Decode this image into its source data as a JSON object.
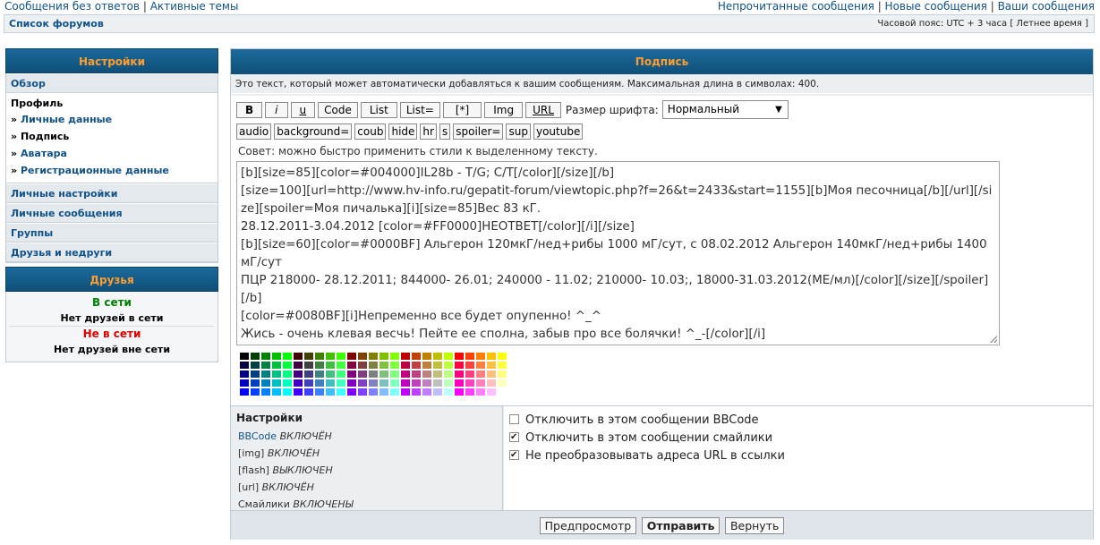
{
  "top_links": {
    "left": [
      "Сообщения без ответов",
      "Активные темы"
    ],
    "right": [
      "Непрочитанные сообщения",
      "Новые сообщения",
      "Ваши сообщения"
    ]
  },
  "navbar": {
    "breadcrumb": "Список форумов",
    "timezone": "Часовой пояс: UTC + 3 часа [ Летнее время ]"
  },
  "sidebar": {
    "title": "Настройки",
    "overview": "Обзор",
    "profile_title": "Профиль",
    "profile_items": [
      {
        "label": "Личные данные",
        "active": false
      },
      {
        "label": "Подпись",
        "active": true
      },
      {
        "label": "Аватара",
        "active": false
      },
      {
        "label": "Регистрационные данные",
        "active": false
      }
    ],
    "items": [
      "Личные настройки",
      "Личные сообщения",
      "Группы",
      "Друзья и недруги"
    ]
  },
  "friends": {
    "title": "Друзья",
    "online_label": "В сети",
    "online_empty": "Нет друзей в сети",
    "offline_label": "Не в сети",
    "offline_empty": "Нет друзей вне сети"
  },
  "main": {
    "title": "Подпись",
    "description": "Это текст, который может автоматически добавляться к вашим сообщениям. Максимальная длина в символах: 400.",
    "toolbar_row1": [
      "B",
      "i",
      "u",
      "Code",
      "List",
      "List=",
      "[*]",
      "Img",
      "URL"
    ],
    "font_size_label": "Размер шрифта:",
    "font_size_value": "Нормальный",
    "toolbar_row2": [
      "audio",
      "background=",
      "coub",
      "hide",
      "hr",
      "s",
      "spoiler=",
      "sup",
      "youtube"
    ],
    "tip": "Совет: можно быстро применить стили к выделенному тексту.",
    "signature_text": "[b][size=85][color=#004000]IL28b - T/G; C/T[/color][/size][/b]\n[size=100][url=http://www.hv-info.ru/gepatit-forum/viewtopic.php?f=26&t=2433&start=1155][b]Моя песочница[/b][/url][/size][spoiler=Моя пичалька][i][size=85]Вес 83 кГ.\n28.12.2011-3.04.2012 [color=#FF0000]НЕОТВЕТ[/color][/i][/size]\n[b][size=60][color=#0000BF] Альгерон 120мкГ/нед+рибы 1000 мГ/сут, с 08.02.2012 Альгерон 140мкГ/нед+рибы 1400 мГ/сут\nПЦР 218000- 28.12.2011; 844000- 26.01; 240000 - 11.02; 210000- 10.03;, 18000-31.03.2012(МЕ/мл)[/color][/size][/spoiler][/b]\n[color=#0080BF][i]Непременно все будет опупенно! ^_^\nЖись - очень клевая весчь! Пейте ее сполна, забыв про все болячки! ^_-[/color][/i]"
  },
  "options": {
    "title": "Настройки",
    "status": [
      {
        "name": "BBCode",
        "state": "ВКЛЮЧЁН",
        "link": true
      },
      {
        "name": "[img]",
        "state": "ВКЛЮЧЁН",
        "link": false
      },
      {
        "name": "[flash]",
        "state": "ВЫКЛЮЧЕН",
        "link": false
      },
      {
        "name": "[url]",
        "state": "ВКЛЮЧЁН",
        "link": false
      },
      {
        "name": "Смайлики",
        "state": "ВКЛЮЧЕНЫ",
        "link": false
      }
    ],
    "checkboxes": [
      {
        "label": "Отключить в этом сообщении BBCode",
        "checked": false
      },
      {
        "label": "Отключить в этом сообщении смайлики",
        "checked": true
      },
      {
        "label": "Не преобразовывать адреса URL в ссылки",
        "checked": true
      }
    ]
  },
  "buttons": {
    "preview": "Предпросмотр",
    "submit": "Отправить",
    "reset": "Вернуть"
  }
}
